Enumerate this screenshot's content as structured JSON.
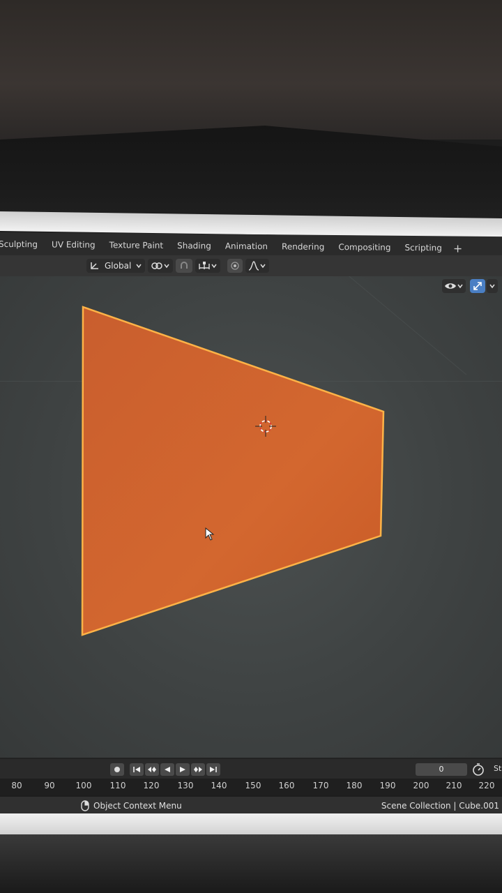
{
  "workspace_tabs": [
    "Sculpting",
    "UV Editing",
    "Texture Paint",
    "Shading",
    "Animation",
    "Rendering",
    "Compositing",
    "Scripting"
  ],
  "add_workspace_label": "+",
  "header": {
    "transform_orientation": "Global"
  },
  "timeline": {
    "current_frame": "0",
    "start_label": "St",
    "ruler_ticks": [
      "80",
      "90",
      "100",
      "110",
      "120",
      "130",
      "140",
      "150",
      "160",
      "170",
      "180",
      "190",
      "200",
      "210",
      "220"
    ]
  },
  "statusbar": {
    "left_hint": "Object Context Menu",
    "right_info": "Scene Collection | Cube.001"
  },
  "colors": {
    "object_fill": "#d2642c",
    "selection_outline": "#ffb347",
    "viewport_bg": "#3f4343",
    "active_toggle": "#4a7fc4"
  },
  "icons": [
    "transform-pivot-icon",
    "snap-icon",
    "proportional-edit-icon",
    "falloff-icon",
    "visibility-icon",
    "gizmo-icon",
    "record-icon",
    "jump-start-icon",
    "prev-keyframe-icon",
    "play-reverse-icon",
    "play-icon",
    "next-keyframe-icon",
    "jump-end-icon",
    "stopwatch-icon",
    "mouse-icon"
  ]
}
